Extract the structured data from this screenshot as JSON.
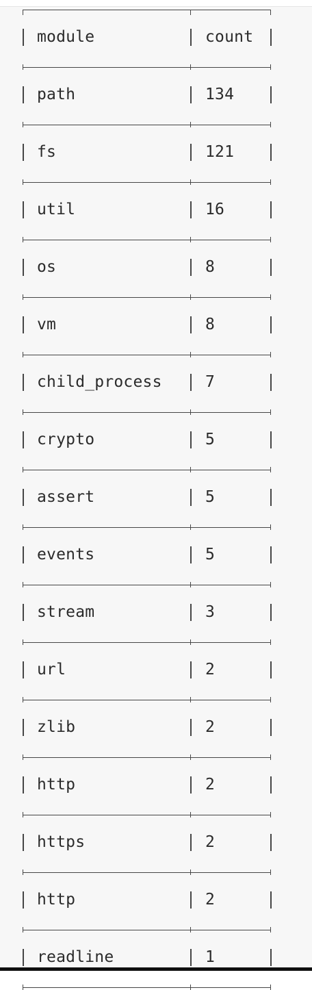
{
  "table": {
    "headers": {
      "module": "module",
      "count": "count"
    },
    "rows": [
      {
        "module": "path",
        "count": "134"
      },
      {
        "module": "fs",
        "count": "121"
      },
      {
        "module": "util",
        "count": "16"
      },
      {
        "module": "os",
        "count": "8"
      },
      {
        "module": "vm",
        "count": "8"
      },
      {
        "module": "child_process",
        "count": "7"
      },
      {
        "module": "crypto",
        "count": "5"
      },
      {
        "module": "assert",
        "count": "5"
      },
      {
        "module": "events",
        "count": "5"
      },
      {
        "module": "stream",
        "count": "3"
      },
      {
        "module": "url",
        "count": "2"
      },
      {
        "module": "zlib",
        "count": "2"
      },
      {
        "module": "http",
        "count": "2"
      },
      {
        "module": "https",
        "count": "2"
      },
      {
        "module": "http",
        "count": "2"
      },
      {
        "module": "readline",
        "count": "1"
      }
    ]
  }
}
